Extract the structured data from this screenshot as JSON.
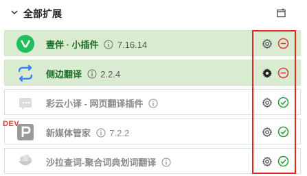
{
  "header": {
    "title": "全部扩展"
  },
  "extensions": [
    {
      "name": "壹伴 · 小插件",
      "version": "7.16.14",
      "enabled": true,
      "logo": "yiban-logo"
    },
    {
      "name": "侧边翻译",
      "version": "2.2.4",
      "enabled": true,
      "logo": "side-translate-logo"
    },
    {
      "name": "彩云小译 - 网页翻译插件",
      "version": "",
      "enabled": false,
      "logo": "caiyun-logo"
    },
    {
      "name": "新媒体管家",
      "version": "7.2.2",
      "enabled": false,
      "logo": "newmedia-logo"
    },
    {
      "name": "沙拉查词-聚合词典划词翻译",
      "version": "",
      "enabled": false,
      "logo": "saladict-logo"
    }
  ],
  "dev_badge": "DEV",
  "colors": {
    "enabled_bg": "#d9ecd2",
    "enabled_name": "#1e6e2a",
    "remove_red": "#e53935",
    "check_green": "#2e9e3c",
    "highlight_red": "#e8231d"
  }
}
